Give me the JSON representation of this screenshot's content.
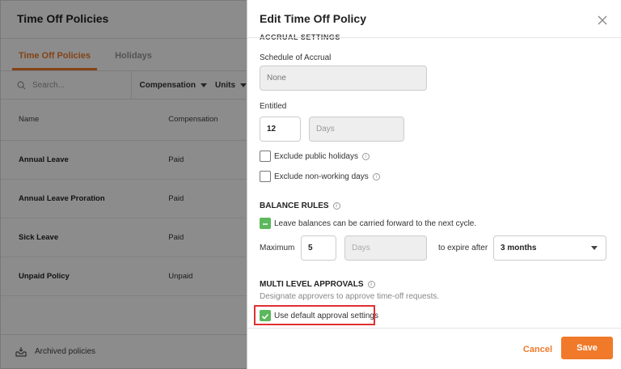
{
  "left": {
    "title": "Time Off Policies",
    "tabs": [
      {
        "label": "Time Off Policies"
      },
      {
        "label": "Holidays"
      }
    ],
    "search_placeholder": "Search...",
    "filters": [
      {
        "label": "Compensation"
      },
      {
        "label": "Units"
      }
    ],
    "columns": [
      "Name",
      "Compensation"
    ],
    "rows": [
      {
        "name": "Annual Leave",
        "compensation": "Paid"
      },
      {
        "name": "Annual Leave Proration",
        "compensation": "Paid"
      },
      {
        "name": "Sick Leave",
        "compensation": "Paid"
      },
      {
        "name": "Unpaid Policy",
        "compensation": "Unpaid"
      }
    ],
    "footer": "Archived policies"
  },
  "modal": {
    "title": "Edit Time Off Policy",
    "cutoff_section": "ACCRUAL SETTINGS",
    "schedule_label": "Schedule of Accrual",
    "schedule_value": "None",
    "entitled_label": "Entitled",
    "entitled_value": "12",
    "entitled_unit": "Days",
    "exclude_public": "Exclude public holidays",
    "exclude_nonworking": "Exclude non-working days",
    "balance_title": "BALANCE RULES",
    "carry_forward": "Leave balances can be carried forward to the next cycle.",
    "maximum_label": "Maximum",
    "maximum_value": "5",
    "maximum_unit": "Days",
    "expire_label": "to expire after",
    "expire_value": "3 months",
    "approvals_title": "MULTI LEVEL APPROVALS",
    "approvals_desc": "Designate approvers to approve time-off requests.",
    "default_approval": "Use default approval settings",
    "cancel": "Cancel",
    "save": "Save"
  },
  "colors": {
    "accent": "#f07a2a",
    "check_green": "#5cb85c",
    "highlight": "#e03030"
  }
}
